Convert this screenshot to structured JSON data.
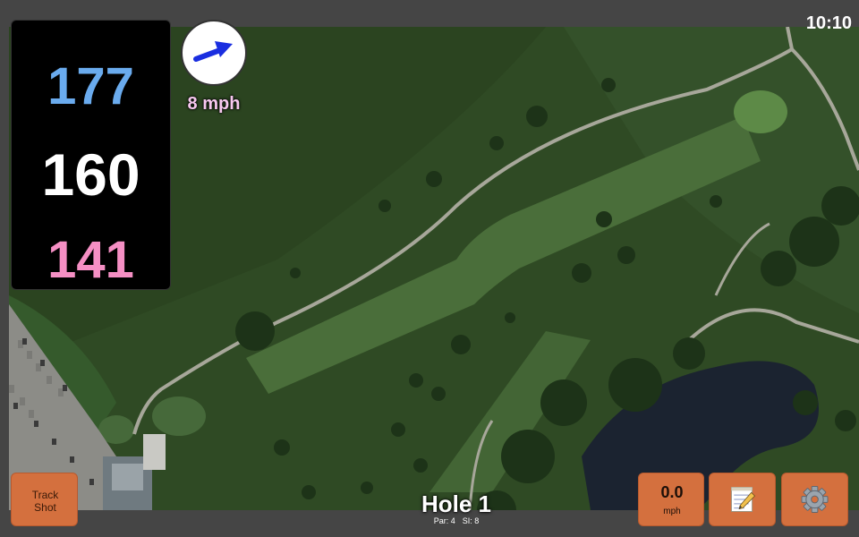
{
  "status": {
    "time": "10:10"
  },
  "distances": {
    "back": "177",
    "middle": "160",
    "front": "141"
  },
  "wind": {
    "speed": "8 mph",
    "arrow_color": "#1a2ee0"
  },
  "hole": {
    "title": "Hole 1",
    "par": "Par: 4",
    "si": "SI: 8"
  },
  "buttons": {
    "track_shot": "Track\nShot",
    "speed_value": "0.0",
    "speed_unit": "mph",
    "notes_icon": "notepad-icon",
    "settings_icon": "gear-icon"
  },
  "colors": {
    "back_distance": "#6aabee",
    "middle_distance": "#ffffff",
    "front_distance": "#f58fc4",
    "button_orange": "#d4703e"
  }
}
